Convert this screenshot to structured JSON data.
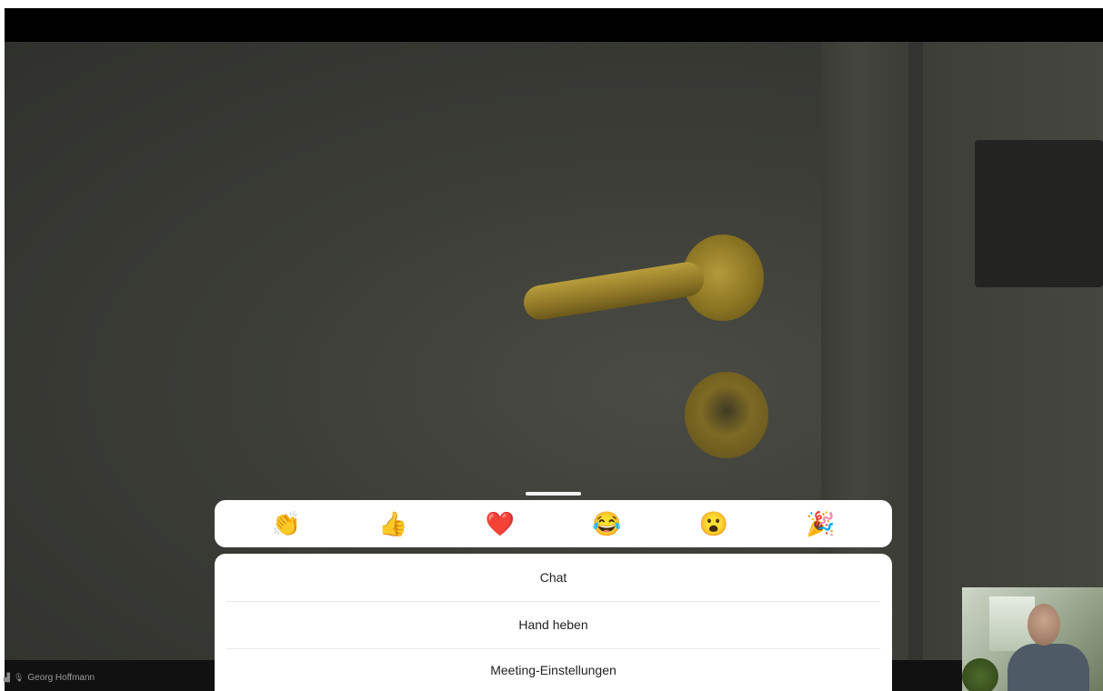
{
  "participant": {
    "name": "Georg Hoffmann",
    "signal_icon": "signal-bars-icon",
    "mic_icon": "microphone-muted-icon"
  },
  "reactions": [
    {
      "name": "clapping-hands-emoji",
      "glyph": "👏"
    },
    {
      "name": "thumbs-up-emoji",
      "glyph": "👍"
    },
    {
      "name": "red-heart-emoji",
      "glyph": "❤️"
    },
    {
      "name": "tears-of-joy-emoji",
      "glyph": "😂"
    },
    {
      "name": "astonished-face-emoji",
      "glyph": "😮"
    },
    {
      "name": "party-popper-emoji",
      "glyph": "🎉"
    }
  ],
  "menu": {
    "items": [
      {
        "label": "Chat"
      },
      {
        "label": "Hand heben"
      },
      {
        "label": "Meeting-Einstellungen"
      }
    ]
  },
  "colors": {
    "sheet_bg": "#ffffff",
    "divider": "#e6e6e6",
    "video_bg": "#000000"
  }
}
